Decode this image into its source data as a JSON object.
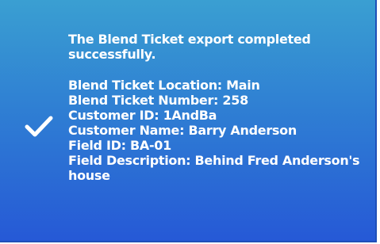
{
  "notification": {
    "headline": "The Blend Ticket export completed successfully.",
    "details": [
      "Blend Ticket Location: Main",
      "Blend Ticket Number: 258",
      "Customer ID: 1AndBa",
      "Customer Name: Barry Anderson",
      "Field ID: BA-01",
      "Field Description: Behind Fred Anderson's house"
    ],
    "icon": "check-icon"
  },
  "colors": {
    "gradient_top": "#3a9fd2",
    "gradient_bottom": "#2659d6",
    "text": "#ffffff"
  }
}
